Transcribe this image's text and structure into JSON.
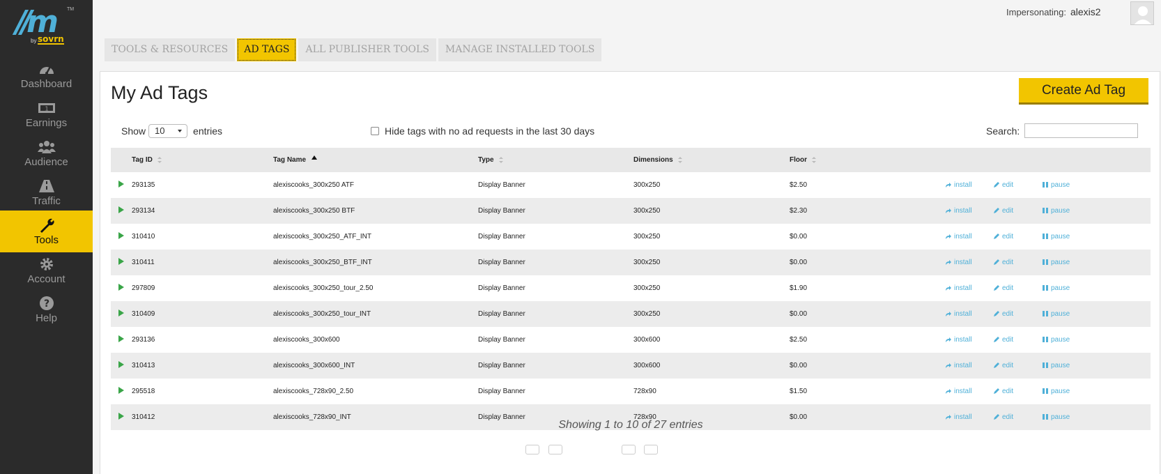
{
  "brand": {
    "slashes": "//m",
    "tm": "TM",
    "by": "by",
    "name": "sovrn"
  },
  "nav": [
    {
      "label": "Dashboard",
      "icon": "gauge-icon"
    },
    {
      "label": "Earnings",
      "icon": "money-icon"
    },
    {
      "label": "Audience",
      "icon": "users-icon"
    },
    {
      "label": "Traffic",
      "icon": "road-icon"
    },
    {
      "label": "Tools",
      "icon": "wrench-icon",
      "active": true
    },
    {
      "label": "Account",
      "icon": "gear-icon"
    },
    {
      "label": "Help",
      "icon": "help-icon"
    }
  ],
  "topbar": {
    "impersonating_label": "Impersonating:",
    "user": "alexis2"
  },
  "tabs": [
    {
      "label": "TOOLS & RESOURCES"
    },
    {
      "label": "AD TAGS",
      "active": true
    },
    {
      "label": "ALL PUBLISHER TOOLS"
    },
    {
      "label": "MANAGE INSTALLED TOOLS"
    }
  ],
  "main": {
    "title": "My Ad Tags",
    "create_button": "Create Ad Tag",
    "show_label": "Show",
    "page_size": "10",
    "entries_label": "entries",
    "hide_label": "Hide tags with no ad requests in the last 30 days",
    "search_label": "Search:",
    "columns": [
      "Tag ID",
      "Tag Name",
      "Type",
      "Dimensions",
      "Floor"
    ],
    "actions": {
      "install": "install",
      "edit": "edit",
      "pause": "pause"
    },
    "rows": [
      {
        "id": "293135",
        "name": "alexiscooks_300x250 ATF",
        "type": "Display Banner",
        "dim": "300x250",
        "floor": "$2.50"
      },
      {
        "id": "293134",
        "name": "alexiscooks_300x250 BTF",
        "type": "Display Banner",
        "dim": "300x250",
        "floor": "$2.30"
      },
      {
        "id": "310410",
        "name": "alexiscooks_300x250_ATF_INT",
        "type": "Display Banner",
        "dim": "300x250",
        "floor": "$0.00"
      },
      {
        "id": "310411",
        "name": "alexiscooks_300x250_BTF_INT",
        "type": "Display Banner",
        "dim": "300x250",
        "floor": "$0.00"
      },
      {
        "id": "297809",
        "name": "alexiscooks_300x250_tour_2.50",
        "type": "Display Banner",
        "dim": "300x250",
        "floor": "$1.90"
      },
      {
        "id": "310409",
        "name": "alexiscooks_300x250_tour_INT",
        "type": "Display Banner",
        "dim": "300x250",
        "floor": "$0.00"
      },
      {
        "id": "293136",
        "name": "alexiscooks_300x600",
        "type": "Display Banner",
        "dim": "300x600",
        "floor": "$2.50"
      },
      {
        "id": "310413",
        "name": "alexiscooks_300x600_INT",
        "type": "Display Banner",
        "dim": "300x600",
        "floor": "$0.00"
      },
      {
        "id": "295518",
        "name": "alexiscooks_728x90_2.50",
        "type": "Display Banner",
        "dim": "728x90",
        "floor": "$1.50"
      },
      {
        "id": "310412",
        "name": "alexiscooks_728x90_INT",
        "type": "Display Banner",
        "dim": "728x90",
        "floor": "$0.00"
      }
    ],
    "summary": "Showing 1 to 10 of 27 entries"
  },
  "colors": {
    "accent": "#f2c500",
    "sidebar": "#2b2b2b",
    "link": "#4fb0d8",
    "play": "#3aa548"
  }
}
